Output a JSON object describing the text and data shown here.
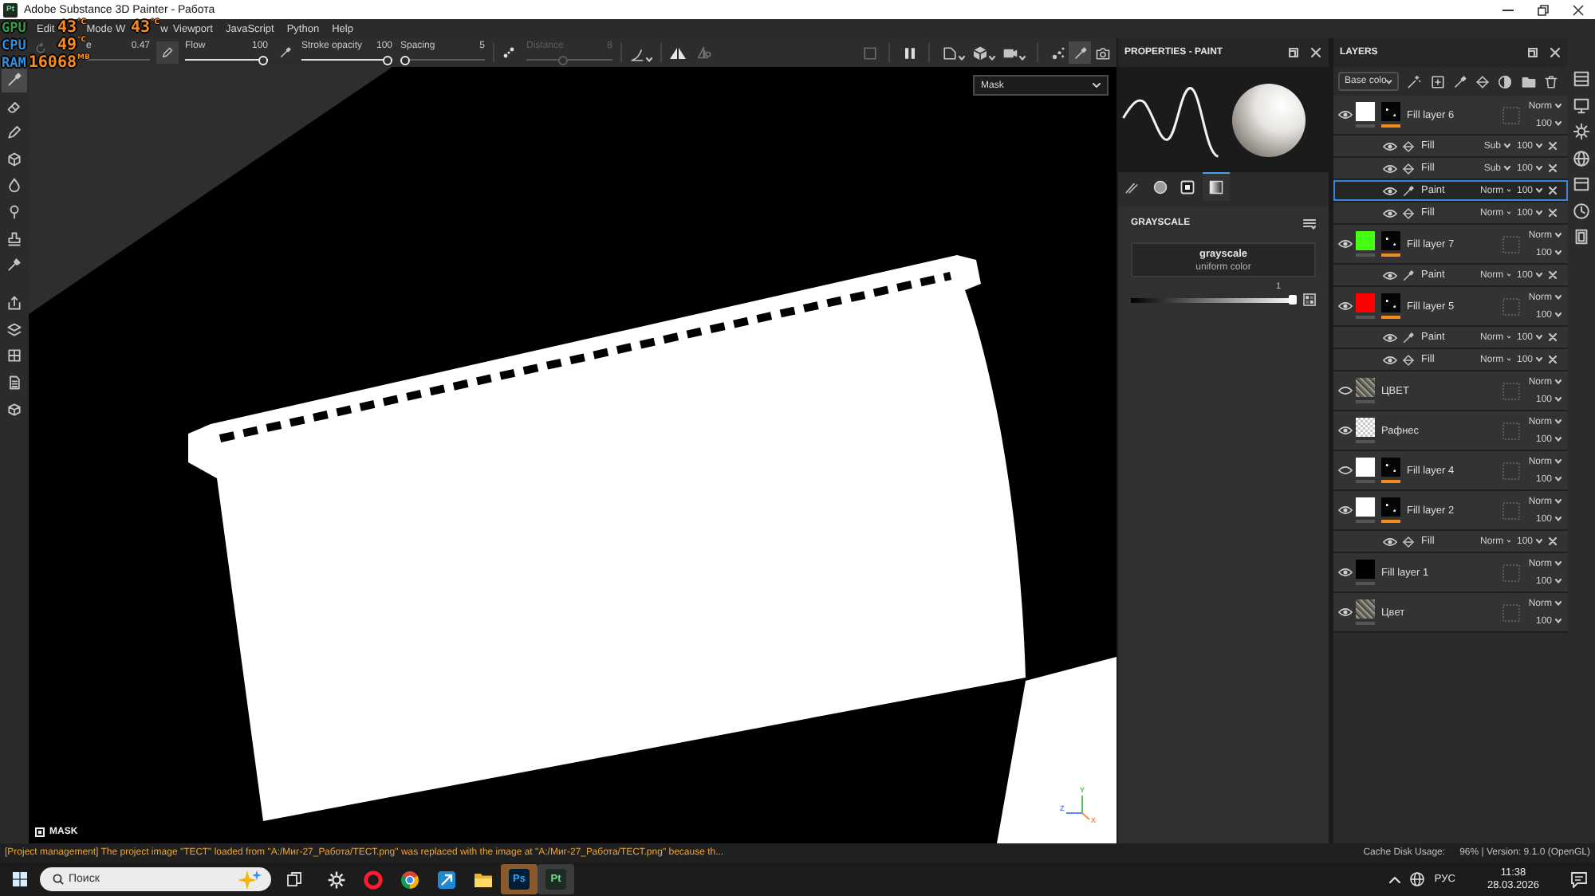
{
  "title_bar": {
    "app_icon": "Pt",
    "title": "Adobe Substance 3D Painter - Работа"
  },
  "menu": [
    {
      "label": "Edit"
    },
    {
      "label": "Mode"
    },
    {
      "label": "W"
    },
    {
      "label": "w"
    },
    {
      "label": "Viewport"
    },
    {
      "label": "JavaScript"
    },
    {
      "label": "Python"
    },
    {
      "label": "Help"
    }
  ],
  "hud": [
    {
      "label": "GPU",
      "color": "#2ea043",
      "readings": [
        {
          "value": "43",
          "unit": "°C"
        },
        {
          "value": "43",
          "unit": "°C"
        }
      ]
    },
    {
      "label": "CPU",
      "color": "#2f8fe0",
      "readings": [
        {
          "value": "49",
          "unit": "°C"
        }
      ]
    },
    {
      "label": "RAM",
      "color": "#2f8fe0",
      "readings": [
        {
          "value": "16068",
          "unit": "MB"
        }
      ]
    }
  ],
  "tool_options": {
    "size": {
      "label": "e",
      "value": "0.47"
    },
    "sliders": [
      {
        "label": "Flow",
        "value": "100",
        "level": 1,
        "disabled": false
      },
      {
        "label": "Stroke opacity",
        "value": "100",
        "level": 1,
        "disabled": false
      },
      {
        "label": "Spacing",
        "value": "5",
        "level": 0,
        "disabled": false
      },
      {
        "label": "Distance",
        "value": "8",
        "level": 0.42,
        "disabled": true
      }
    ]
  },
  "viewport_tools": [
    {
      "selected": false
    },
    {
      "selected": false
    },
    {
      "selected": false
    },
    {
      "selected": false
    },
    {
      "selected": false
    },
    {
      "selected": false
    },
    {
      "selected": true
    },
    {
      "selected": false
    }
  ],
  "tools": [
    {
      "selected": true
    },
    {
      "selected": false
    },
    {
      "selected": false
    },
    {
      "selected": false
    },
    {
      "selected": false
    },
    {
      "selected": false
    },
    {
      "selected": false
    },
    {
      "selected": false
    },
    {
      "selected": false
    },
    {
      "selected": false
    },
    {
      "selected": false
    },
    {
      "selected": false
    },
    {
      "selected": false
    }
  ],
  "viewport": {
    "channel": "Mask",
    "label": "MASK",
    "axes": [
      {
        "label": "Y"
      },
      {
        "label": "Z"
      },
      {
        "label": "X"
      }
    ]
  },
  "properties": {
    "title": "PROPERTIES - PAINT",
    "tabs": [
      {
        "selected": false
      },
      {
        "selected": false
      },
      {
        "selected": false
      },
      {
        "selected": true
      }
    ],
    "section": "GRAYSCALE",
    "material": {
      "name": "grayscale",
      "type": "uniform color"
    },
    "value": "1",
    "level": 1
  },
  "layers": {
    "title": "LAYERS",
    "channel": "Base colo",
    "items": [
      {
        "name": "Fill layer 6",
        "visible": true,
        "selected": false,
        "thumbnail": {
          "kind": "color",
          "color": "#ffffff"
        },
        "mask": {
          "selected": true
        },
        "blend": "Norm",
        "opacity": "100",
        "effects": [
          {
            "kind": "fill",
            "name": "Fill",
            "visible": true,
            "selected": false,
            "blend": "Sub",
            "opacity": "100"
          },
          {
            "kind": "fill",
            "name": "Fill",
            "visible": true,
            "selected": false,
            "blend": "Sub",
            "opacity": "100"
          },
          {
            "kind": "paint",
            "name": "Paint",
            "visible": true,
            "selected": true,
            "blend": "Norm",
            "opacity": "100"
          },
          {
            "kind": "fill",
            "name": "Fill",
            "visible": true,
            "selected": false,
            "blend": "Norm",
            "opacity": "100"
          }
        ]
      },
      {
        "name": "Fill layer 7",
        "visible": true,
        "selected": false,
        "thumbnail": {
          "kind": "color",
          "color": "#44ff11"
        },
        "mask": {
          "selected": true
        },
        "blend": "Norm",
        "opacity": "100",
        "effects": [
          {
            "kind": "paint",
            "name": "Paint",
            "visible": true,
            "selected": false,
            "blend": "Norm",
            "opacity": "100"
          }
        ]
      },
      {
        "name": "Fill layer 5",
        "visible": true,
        "selected": false,
        "thumbnail": {
          "kind": "color",
          "color": "#ff0000"
        },
        "mask": {
          "selected": true
        },
        "blend": "Norm",
        "opacity": "100",
        "effects": [
          {
            "kind": "paint",
            "name": "Paint",
            "visible": true,
            "selected": false,
            "blend": "Norm",
            "opacity": "100"
          },
          {
            "kind": "fill",
            "name": "Fill",
            "visible": true,
            "selected": false,
            "blend": "Norm",
            "opacity": "100"
          }
        ]
      },
      {
        "name": "ЦВЕТ",
        "visible": false,
        "selected": false,
        "thumbnail": {
          "kind": "texture"
        },
        "blend": "Norm",
        "opacity": "100"
      },
      {
        "name": "Рафнес",
        "visible": true,
        "selected": false,
        "thumbnail": {
          "kind": "checker"
        },
        "blend": "Norm",
        "opacity": "100"
      },
      {
        "name": "Fill layer 4",
        "visible": false,
        "selected": false,
        "thumbnail": {
          "kind": "color",
          "color": "#ffffff"
        },
        "mask": {
          "selected": true
        },
        "blend": "Norm",
        "opacity": "100"
      },
      {
        "name": "Fill layer 2",
        "visible": true,
        "selected": false,
        "thumbnail": {
          "kind": "color",
          "color": "#ffffff"
        },
        "mask": {
          "selected": true
        },
        "blend": "Norm",
        "opacity": "100",
        "effects": [
          {
            "kind": "fill",
            "name": "Fill",
            "visible": true,
            "selected": false,
            "blend": "Norm",
            "opacity": "100"
          }
        ]
      },
      {
        "name": "Fill layer 1",
        "visible": true,
        "selected": false,
        "thumbnail": {
          "kind": "color",
          "color": "#000000"
        },
        "blend": "Norm",
        "opacity": "100"
      },
      {
        "name": "Цвет",
        "visible": true,
        "selected": false,
        "thumbnail": {
          "kind": "texture"
        },
        "blend": "Norm",
        "opacity": "100"
      }
    ]
  },
  "status_bar": {
    "message": "[Project management] The project image \"ТЕСТ\" loaded from \"A:/Миг-27_Работа/ТЕСТ.png\" was replaced with the image at \"A:/Миг-27_Работа/ТЕСТ.png\" because th...",
    "cache_label": "Cache Disk Usage:",
    "cache_info": "96% | Version: 9.1.0 (OpenGL)"
  },
  "taskbar": {
    "search": {
      "placeholder": "Поиск"
    },
    "apps": [
      {
        "active": false,
        "attention": false
      },
      {
        "active": false,
        "attention": false
      },
      {
        "active": false,
        "attention": false
      },
      {
        "active": false,
        "attention": false
      },
      {
        "active": false,
        "attention": false
      },
      {
        "label": "Ps",
        "active": false,
        "attention": true
      },
      {
        "label": "Pt",
        "active": true,
        "attention": false
      }
    ],
    "tray": {
      "language": "РУС",
      "time": "11:38",
      "date": "28.03.2026"
    }
  }
}
